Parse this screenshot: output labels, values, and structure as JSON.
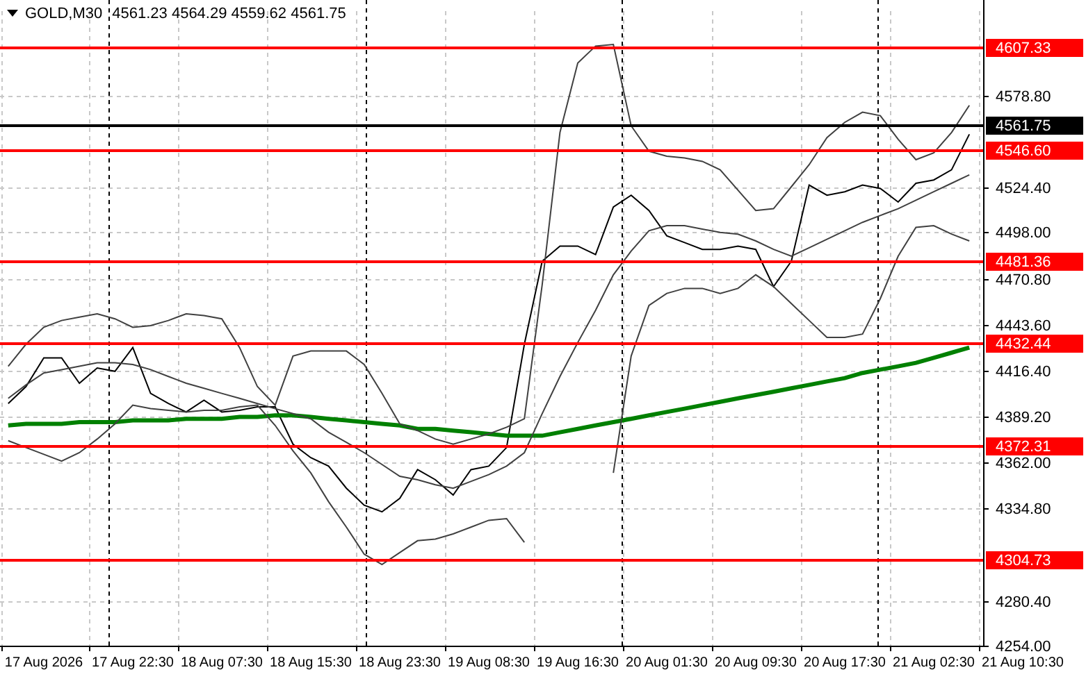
{
  "header": {
    "symbol": "GOLD,M30",
    "ohlc": "4561.23 4564.29 4559.62 4561.75"
  },
  "chart_data": {
    "type": "line",
    "ylim": [
      4254,
      4628.7
    ],
    "grid": true,
    "categories": [
      null,
      null,
      "17 Aug 2026",
      null,
      null,
      null,
      null,
      "17 Aug 22:30",
      null,
      null,
      null,
      null,
      "18 Aug 07:30",
      null,
      null,
      null,
      null,
      "18 Aug 15:30",
      null,
      null,
      null,
      null,
      "18 Aug 23:30",
      null,
      null,
      null,
      null,
      "19 Aug 08:30",
      null,
      null,
      null,
      null,
      "19 Aug 16:30",
      null,
      null,
      null,
      null,
      "20 Aug 01:30",
      null,
      null,
      null,
      null,
      "20 Aug 09:30",
      null,
      null,
      null,
      null,
      "20 Aug 17:30",
      null,
      null,
      null,
      null,
      "21 Aug 02:30",
      null,
      null,
      null,
      null,
      "21 Aug 10:30"
    ],
    "series": [
      {
        "color": "#000000",
        "values": [
          4397,
          4407,
          4424,
          4424,
          4409,
          4418,
          4416,
          4430,
          4403,
          4397,
          4392,
          4399,
          4392,
          4393,
          4395,
          4395,
          4373,
          4365,
          4360,
          4347,
          4337,
          4333,
          4341,
          4358,
          4352,
          4343,
          4358,
          4360,
          4371,
          4432,
          4481,
          4490,
          4490,
          4485,
          4513,
          4520,
          4511,
          4496,
          4492,
          4488,
          4488,
          4490,
          4488,
          4466,
          4481,
          4526,
          4520,
          4522,
          4526,
          4524,
          4516,
          4527,
          4529,
          4535,
          4556,
          null,
          null,
          null
        ]
      },
      {
        "color": "#008000",
        "values": [
          4384,
          4385,
          4385,
          4385,
          4386,
          4386,
          4386,
          4387,
          4387,
          4387,
          4388,
          4388,
          4388,
          4389,
          4389,
          4390,
          4390,
          4389,
          4388,
          4387,
          4386,
          4385,
          4384,
          4382,
          4382,
          4381,
          4380,
          4379,
          4378,
          4378,
          4378,
          4380,
          4382,
          4384,
          4386,
          4388,
          4390,
          4392,
          4394,
          4396,
          4398,
          4400,
          4402,
          4404,
          4406,
          4408,
          4410,
          4412,
          4415,
          4417,
          4419,
          4421,
          4424,
          4427,
          4430,
          null,
          null,
          null
        ]
      },
      {
        "color": "#404040",
        "values": [
          4419,
          4432,
          4442,
          4446,
          4448,
          4450,
          4447,
          4442,
          4443,
          4446,
          4450,
          4449,
          4447,
          4430,
          4407,
          4396,
          4425,
          4428,
          4428,
          4428,
          4420,
          4403,
          4385,
          4381,
          4376,
          4373,
          4376,
          4379,
          4383,
          4388,
          4467,
          4557,
          4598,
          4608,
          4609,
          4561,
          4546,
          4543,
          4542,
          4540,
          4535,
          4523,
          4511,
          4512,
          4525,
          4538,
          4554,
          4563,
          4569,
          4567,
          4553,
          4541,
          4545,
          4557,
          4573,
          null,
          null,
          null
        ]
      },
      {
        "color": "#404040",
        "values": [
          4400,
          4408,
          4415,
          4417,
          4419,
          4421,
          4421,
          4420,
          4417,
          4413,
          4409,
          4406,
          4403,
          4400,
          4397,
          4394,
          4391,
          4388,
          4380,
          4374,
          4368,
          4361,
          4354,
          4352,
          4349,
          4347,
          4351,
          4355,
          4360,
          4368,
          4391,
          4413,
          4433,
          4452,
          4473,
          4487,
          4499,
          4502,
          4502,
          4500,
          4498,
          4497,
          4493,
          4488,
          4484,
          4489,
          4494,
          4499,
          4504,
          4508,
          4512,
          4517,
          4522,
          4527,
          4532,
          null,
          null,
          null
        ]
      },
      {
        "color": "#404040",
        "values": [
          4375,
          4371,
          4367,
          4363,
          4368,
          4376,
          4385,
          4396,
          4394,
          4393,
          4392,
          4393,
          4393,
          4395,
          4396,
          4384,
          4369,
          4356,
          4339,
          4324,
          4308,
          4302,
          4309,
          4316,
          4317,
          4320,
          4324,
          4328,
          4329,
          4315,
          null,
          null,
          null,
          null,
          4356,
          4425,
          4455,
          4462,
          4465,
          4465,
          4462,
          4465,
          4473,
          4466,
          4456,
          4446,
          4436,
          4436,
          4438,
          4459,
          4484,
          4501,
          4502,
          4497,
          4493,
          null,
          null,
          null
        ]
      }
    ],
    "yticks": [
      {
        "value": 4578.8,
        "label": "4578.80"
      },
      {
        "value": 4524.4,
        "label": "4524.40"
      },
      {
        "value": 4498.0,
        "label": "4498.00"
      },
      {
        "value": 4470.8,
        "label": "4470.80"
      },
      {
        "value": 4443.6,
        "label": "4443.60"
      },
      {
        "value": 4416.4,
        "label": "4416.40"
      },
      {
        "value": 4389.2,
        "label": "4389.20"
      },
      {
        "value": 4362.0,
        "label": "4362.00"
      },
      {
        "value": 4334.8,
        "label": "4334.80"
      },
      {
        "value": 4280.4,
        "label": "4280.40"
      },
      {
        "value": 4254.0,
        "label": "4254.00"
      }
    ],
    "ref_lines": [
      {
        "axis": "y",
        "value": 4607.33,
        "label": "4607.33",
        "color": "#ff0000"
      },
      {
        "axis": "y",
        "value": 4561.75,
        "label": "4561.75",
        "color": "#000000"
      },
      {
        "axis": "y",
        "value": 4546.6,
        "label": "4546.60",
        "color": "#ff0000"
      },
      {
        "axis": "y",
        "value": 4481.36,
        "label": "4481.36",
        "color": "#ff0000"
      },
      {
        "axis": "y",
        "value": 4432.44,
        "label": "4432.44",
        "color": "#ff0000"
      },
      {
        "axis": "y",
        "value": 4372.31,
        "label": "4372.31",
        "color": "#ff0000"
      },
      {
        "axis": "y",
        "value": 4304.73,
        "label": "4304.73",
        "color": "#ff0000"
      }
    ]
  }
}
